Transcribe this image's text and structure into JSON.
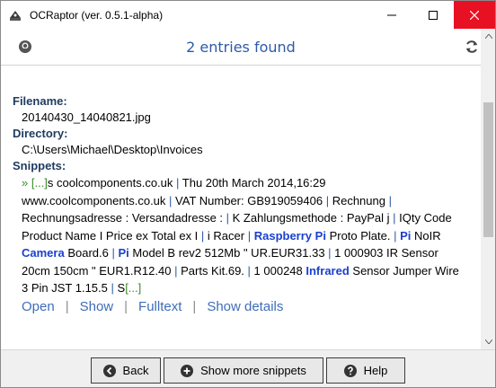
{
  "window": {
    "title": "OCRaptor (ver. 0.5.1-alpha)",
    "icons": [
      "app-icon",
      "minimize-icon",
      "maximize-icon",
      "close-icon"
    ]
  },
  "header": {
    "title": "2 entries found",
    "icons": [
      "github-icon",
      "refresh-icon"
    ]
  },
  "entry": {
    "filename_label": "Filename:",
    "filename": "20140430_14040821.jpg",
    "directory_label": "Directory:",
    "directory": "C:\\Users\\Michael\\Desktop\\Invoices",
    "snippets_label": "Snippets:",
    "snippet": {
      "bullet": "»",
      "lead_ellipsis": "[...]",
      "p1": "s coolcomponents.co.uk ",
      "s1": "|",
      "p2": " Thu 20th March 2014,16:29 www.coolcomponents.co.uk ",
      "s2": "|",
      "p3": " VAT Number: GB919059406 ",
      "s3": "|",
      "p4": " Rechnung ",
      "s4": "|",
      "p5": " Rechnungsadresse : Versandadresse : ",
      "s5": "|",
      "p6": " K Zahlungsmethode : PayPal j ",
      "s6": "|",
      "p7": " IQty Code Product Name I Price ex Total ex I ",
      "s7": "|",
      "p8": " i Racer ",
      "s8": "|",
      "p9": " ",
      "hl1": "Raspberry",
      "p10": " ",
      "hl2": "Pi",
      "p11": " Proto Plate. ",
      "s9": "|",
      "p12": " ",
      "hl3": "Pi",
      "p13": " NoIR ",
      "hl4": "Camera",
      "p14": " Board.6 ",
      "s10": "|",
      "p15": " ",
      "hl5": "Pi",
      "p16": " Model B rev2 512Mb \" UR.EUR31.33 ",
      "s11": "|",
      "p17": " 1 000903 IR Sensor 20cm 150cm \" EUR1.R12.40 ",
      "s12": "|",
      "p18": " Parts Kit.69. ",
      "s13": "|",
      "p19": " 1 000248 ",
      "hl6": "Infrared",
      "p20": " Sensor Jumper Wire 3 Pin JST 1.15.5 ",
      "s14": "|",
      "p21": " S",
      "trail_ellipsis": "[...]"
    },
    "actions": {
      "open": "Open",
      "show": "Show",
      "fulltext": "Fulltext",
      "show_details": "Show details",
      "separator": "|"
    }
  },
  "footer": {
    "back_label": "Back",
    "more_label": "Show more snippets",
    "help_label": "Help",
    "icons": [
      "back-icon",
      "plus-icon",
      "help-icon"
    ]
  },
  "colors": {
    "close_button": "#e81123",
    "header_title": "#2e5aa8",
    "label": "#1f3a5f",
    "highlight": "#1a3fd0",
    "ellipsis": "#3a8a2a",
    "link": "#3f6db8"
  }
}
